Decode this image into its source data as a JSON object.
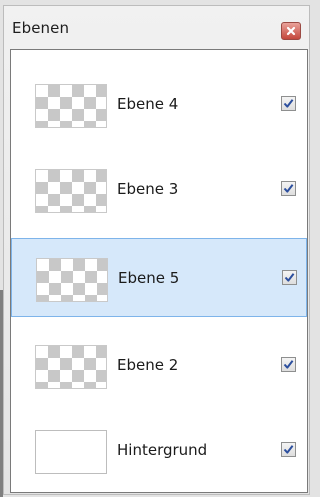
{
  "window": {
    "title": "Ebenen",
    "close_icon": "close-x-icon",
    "accent_close": "#d0564b"
  },
  "layers": [
    {
      "name": "Ebene 4",
      "visible": true,
      "thumbnail": "transparent-checker",
      "selected": false
    },
    {
      "name": "Ebene 3",
      "visible": true,
      "thumbnail": "transparent-checker",
      "selected": false
    },
    {
      "name": "Ebene 5",
      "visible": true,
      "thumbnail": "transparent-checker",
      "selected": true
    },
    {
      "name": "Ebene 2",
      "visible": true,
      "thumbnail": "transparent-checker",
      "selected": false
    },
    {
      "name": "Hintergrund",
      "visible": true,
      "thumbnail": "white",
      "selected": false
    }
  ],
  "colors": {
    "selection_fill": "#d6e8fa",
    "selection_border": "#7eb4ea",
    "checkmark": "#2c4f9e"
  }
}
